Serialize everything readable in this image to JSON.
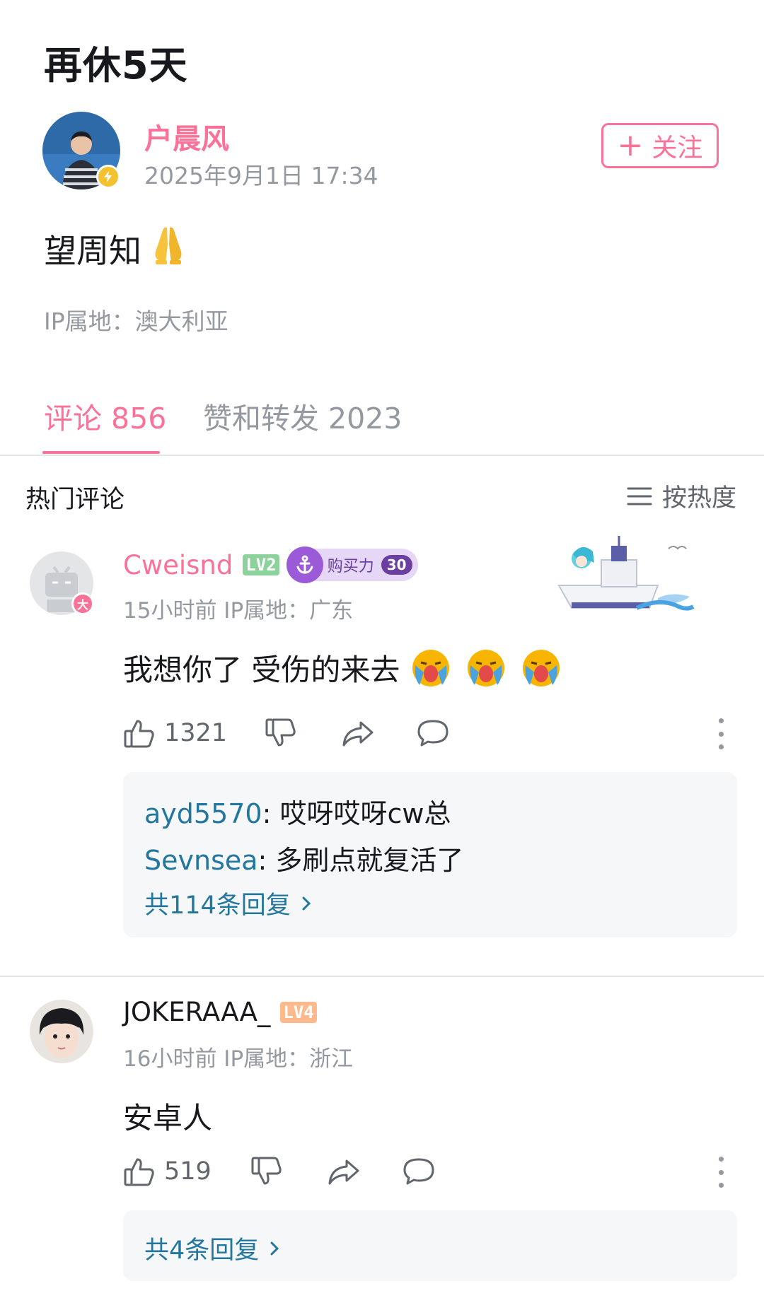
{
  "post": {
    "title": "再休5天",
    "author": "户晨风",
    "time": "2025年9月1日 17:34",
    "follow_label": "关注",
    "body": "望周知",
    "ip": "IP属地：澳大利亚"
  },
  "tabs": [
    {
      "label": "评论 856"
    },
    {
      "label": "赞和转发 2023"
    }
  ],
  "comments_header": {
    "title": "热门评论",
    "sort_label": "按热度"
  },
  "comments": [
    {
      "user": "Cweisnd",
      "level": "LV2",
      "badge_label": "购买力",
      "badge_num": "30",
      "meta": "15小时前 IP属地：广东",
      "text": "我想你了 受伤的来去",
      "likes": "1321",
      "replies": [
        {
          "user": "ayd5570",
          "text": ": 哎呀哎呀cw总"
        },
        {
          "user": "Sevnsea",
          "text": ": 多刷点就复活了"
        }
      ],
      "reply_more": "共114条回复",
      "level_color": "#8bd29b",
      "name_color": "#fb7299"
    },
    {
      "user": "JOKERAAA_",
      "level": "LV4",
      "meta": "16小时前 IP属地：浙江",
      "text": "安卓人",
      "likes": "519",
      "reply_more": "共4条回复",
      "level_color": "#feba8d",
      "name_color": "#18191c"
    }
  ],
  "colors": {
    "accent": "#fb7299",
    "link": "#23769e",
    "muted": "#9499a0"
  },
  "icons": [
    "verify-bolt-icon",
    "plus-icon",
    "praying-hands-emoji",
    "menu-lines-icon",
    "thumb-up-icon",
    "thumb-down-icon",
    "share-icon",
    "reply-bubble-icon",
    "more-dots-icon",
    "crying-emoji",
    "chevron-right-icon"
  ]
}
